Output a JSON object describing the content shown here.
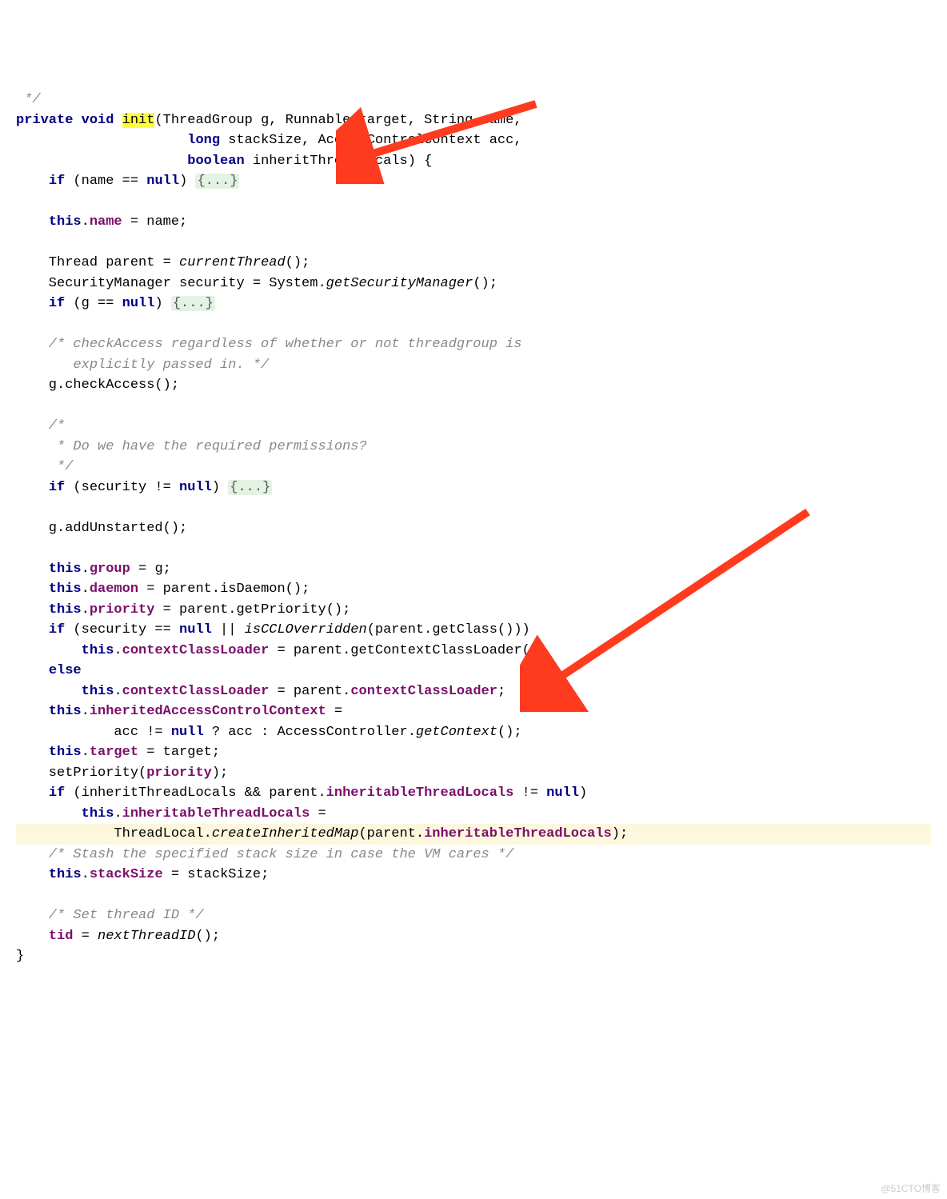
{
  "kw": {
    "private": "private",
    "void": "void",
    "long": "long",
    "boolean": "boolean",
    "if": "if",
    "null": "null",
    "this": "this",
    "else": "else"
  },
  "method": "init",
  "sig": {
    "p1": "(ThreadGroup g, Runnable target, String name,",
    "p2": "                     ",
    "p2b": " stackSize, AccessControlContext acc,",
    "p3": "                     ",
    "p3b": " inheritThreadLocals) {"
  },
  "fold": "{...}",
  "l": {
    "if_name": "    ",
    "if_name2": " (name == ",
    "if_name3": ") ",
    "blank": "",
    "this_name_a": "    ",
    "this_name_b": ".",
    "name_field": "name",
    "this_name_c": " = name;",
    "thread_parent": "    Thread parent = ",
    "currentThread": "currentThread",
    "thread_parent2": "();",
    "security": "    SecurityManager security = System.",
    "getSecMgr": "getSecurityManager",
    "security2": "();",
    "if_g_a": "    ",
    "if_g_b": " (g == ",
    "if_g_c": ") ",
    "comment1a": "    /* checkAccess regardless of whether or not threadgroup is",
    "comment1b": "       explicitly passed in. */",
    "checkAccess": "    g.checkAccess();",
    "comment2a": "    /*",
    "comment2b": "     * Do we have the required permissions?",
    "comment2c": "     */",
    "if_sec_a": "    ",
    "if_sec_b": " (security != ",
    "if_sec_c": ") ",
    "addUnstarted": "    g.addUnstarted();",
    "group_a": "    ",
    "group_b": ".",
    "group_field": "group",
    "group_c": " = g;",
    "daemon_a": "    ",
    "daemon_b": ".",
    "daemon_field": "daemon",
    "daemon_c": " = parent.isDaemon();",
    "priority_a": "    ",
    "priority_b": ".",
    "priority_field": "priority",
    "priority_c": " = parent.getPriority();",
    "if_cc_a": "    ",
    "if_cc_b": " (security == ",
    "if_cc_c": " || ",
    "isCCL": "isCCLOverridden",
    "if_cc_d": "(parent.getClass()))",
    "ccl_a": "        ",
    "ccl_b": ".",
    "ccl_field": "contextClassLoader",
    "ccl_c": " = parent.getContextClassLoader();",
    "else_line": "    ",
    "ccl2_a": "        ",
    "ccl2_b": ".",
    "ccl2_c": " = parent.",
    "ccl2_field2": "contextClassLoader",
    "ccl2_d": ";",
    "iacc_a": "    ",
    "iacc_b": ".",
    "iacc_field": "inheritedAccessControlContext",
    "iacc_c": " =",
    "iacc2_a": "            acc != ",
    "iacc2_b": " ? acc : AccessController.",
    "getContext": "getContext",
    "iacc2_c": "();",
    "target_a": "    ",
    "target_b": ".",
    "target_field": "target",
    "target_c": " = target;",
    "setPri_a": "    setPriority(",
    "setPri_field": "priority",
    "setPri_b": ");",
    "if_itl_a": "    ",
    "if_itl_b": " (inheritThreadLocals && parent.",
    "itl_field": "inheritableThreadLocals",
    "if_itl_c": " != ",
    "if_itl_d": ")",
    "itl2_a": "        ",
    "itl2_b": ".",
    "itl2_c": " =",
    "itl3_a": "            ThreadLocal.",
    "createMap": "createInheritedMap",
    "itl3_b": "(parent.",
    "itl3_c": ");",
    "comment3": "    /* Stash the specified stack size in case the VM cares */",
    "stack_a": "    ",
    "stack_b": ".",
    "stack_field": "stackSize",
    "stack_c": " = stackSize;",
    "comment4": "    /* Set thread ID */",
    "tid_a": "    ",
    "tid_field": "tid",
    "tid_b": " = ",
    "nextTID": "nextThreadID",
    "tid_c": "();",
    "close": "}"
  },
  "watermark": "@51CTO博客",
  "arrows": {
    "arrow1_color": "#ff3b1f",
    "arrow2_color": "#ff3b1f"
  }
}
